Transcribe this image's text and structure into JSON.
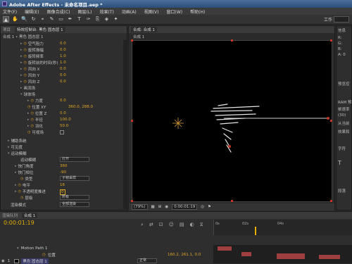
{
  "window": {
    "title": "Adobe After Effects - 未命名项目.aep *"
  },
  "menu": [
    "文件(F)",
    "编辑(E)",
    "图像合成(C)",
    "图层(L)",
    "效果(T)",
    "动画(A)",
    "视图(V)",
    "窗口(W)",
    "帮助(H)"
  ],
  "toolbar": {
    "tools": [
      "▲",
      "✋",
      "🔍",
      "↻",
      "⌖",
      "✎",
      "▭",
      "✒",
      "T",
      "✑",
      "⎘",
      "◈",
      "✦"
    ],
    "workspace_label": "工作"
  },
  "left_panel": {
    "tabs": [
      "项目",
      "特效控制台: 黑色 固态层 1"
    ],
    "breadcrumb": "合成 1 • 黑色 固态层 1",
    "rows": [
      {
        "label": "空气阻力",
        "value": "0.0"
      },
      {
        "label": "旋转振幅",
        "value": "0.0"
      },
      {
        "label": "旋转频率",
        "value": "1.0"
      },
      {
        "label": "旋转前的时间(秒)",
        "value": "1.0"
      },
      {
        "label": "风向 X",
        "value": "0.0"
      },
      {
        "label": "风向 Y",
        "value": "0.0"
      },
      {
        "label": "风向 Z",
        "value": "0.0"
      },
      {
        "label": "画流场",
        "value": ""
      },
      {
        "label": "球体场",
        "value": ""
      },
      {
        "label": "力度",
        "value": "0.0"
      },
      {
        "label": "位置 XY",
        "value": "360.0, 288.0"
      },
      {
        "label": "位置 Z",
        "value": "0.0"
      },
      {
        "label": "半径",
        "value": "100.0"
      },
      {
        "label": "羽化",
        "value": "50.0"
      },
      {
        "label": "可视场",
        "value": ""
      },
      {
        "label": "辅助系统",
        "value": ""
      },
      {
        "label": "可见度",
        "value": ""
      },
      {
        "label": "运动模糊",
        "value": ""
      },
      {
        "label": "运动模糊",
        "value": "打开"
      },
      {
        "label": "快门角度",
        "value": "360"
      },
      {
        "label": "快门相位",
        "value": "-90"
      },
      {
        "label": "类型",
        "value": "子帧采样"
      },
      {
        "label": "电平",
        "value": "16"
      },
      {
        "label": "不透明度推进",
        "value": "0"
      },
      {
        "label": "层级",
        "value": "所有"
      },
      {
        "label": "渲染模式",
        "value": "全部渲染"
      }
    ]
  },
  "comp_panel": {
    "tab": "合成: 合成 1",
    "breadcrumb": "合成 1",
    "zoom": "(79%)",
    "timecode": "0:00:01:19"
  },
  "right_panel": {
    "labels": [
      "信息",
      "R:",
      "G:",
      "B:",
      "A: 0",
      "预览控",
      "RAM 预",
      "帧速率",
      "(30)",
      "从当前",
      "效果和",
      "字符",
      "T",
      "段落"
    ]
  },
  "timeline": {
    "tabs": [
      "渲染队列",
      "合成 1"
    ],
    "current_time": "0:00:01:19",
    "ruler": [
      "0s",
      "02s",
      "04s"
    ],
    "layers": [
      {
        "num": "",
        "name": "Motion Path 1",
        "value": ""
      },
      {
        "num": "",
        "name": "位置",
        "value": "160.2, 261.1, 0.0"
      },
      {
        "num": "1",
        "name": "黑色 固态层 1",
        "value": "正常"
      }
    ]
  },
  "colors": {
    "accent_value": "#e0a524",
    "handle": "#c0392b",
    "timeline_time": "#e5b100"
  }
}
